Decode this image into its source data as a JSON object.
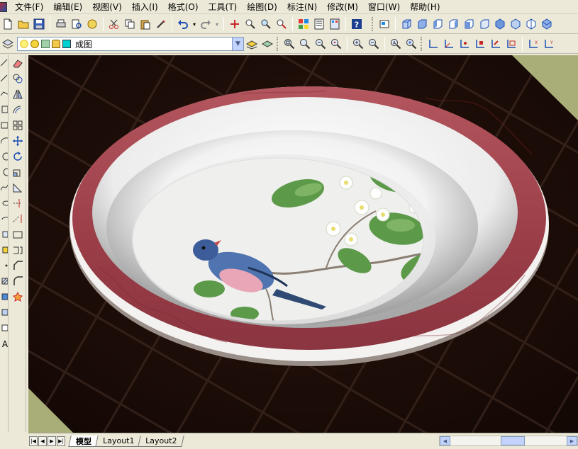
{
  "menu": {
    "items": [
      {
        "label": "文件(F)"
      },
      {
        "label": "编辑(E)"
      },
      {
        "label": "视图(V)"
      },
      {
        "label": "插入(I)"
      },
      {
        "label": "格式(O)"
      },
      {
        "label": "工具(T)"
      },
      {
        "label": "绘图(D)"
      },
      {
        "label": "标注(N)"
      },
      {
        "label": "修改(M)"
      },
      {
        "label": "窗口(W)"
      },
      {
        "label": "帮助(H)"
      }
    ]
  },
  "layer_toolbar": {
    "current_layer": "成图",
    "layer_color": "#00d0d0"
  },
  "layout_tabs": {
    "tabs": [
      {
        "label": "模型",
        "active": true
      },
      {
        "label": "Layout1",
        "active": false
      },
      {
        "label": "Layout2",
        "active": false
      }
    ]
  },
  "colors": {
    "rim_red": "#a3444e",
    "viewport_bg": "#1e0e09",
    "accent_corner": "#a9ae78"
  }
}
